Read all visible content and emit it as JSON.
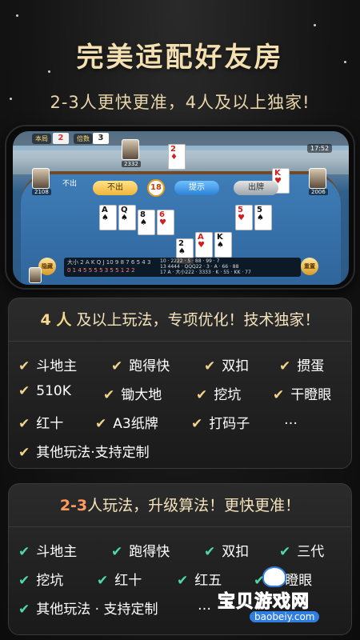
{
  "header": {
    "headline": "完美适配好友房",
    "subline": "2-3人更快更准，4人及以上独家!"
  },
  "screenshot": {
    "top_mult_label": "倍数",
    "top_base_label": "本局",
    "top_base_value": "2",
    "top_mult_value": "3",
    "clock": "17:52",
    "player_top_score": "2332",
    "player_left_score": "2108",
    "player_right_score": "2006",
    "chu_label": "不出",
    "timer": "18",
    "btn_pass": "不出",
    "btn_hint": "提示",
    "btn_play": "出牌",
    "left_btn": "隐藏",
    "right_btn": "重置",
    "tracker_row1": "大小 2 A K Q J 10 9 8 7 6 5 4 3",
    "tracker_row2": "0 1 4 5 5 5 5 3 5 5 1 2 2",
    "tracker_side": "10 · 2222 · 5 · 88 · 99 · 7\n13 4444 · QQQ22 · 3 · A · 66 · 88\n17 A · 大小222 · 3333 · K · 55 · KK · 77",
    "played_card": "2",
    "right_card": "K",
    "hand_cards": [
      {
        "r": "A",
        "s": "♠",
        "c": "blk"
      },
      {
        "r": "Q",
        "s": "♠",
        "c": "blk"
      },
      {
        "r": "10",
        "s": "♠",
        "c": "blk"
      },
      {
        "r": "8",
        "s": "♠",
        "c": "blk"
      },
      {
        "r": "6",
        "s": "♥",
        "c": "red"
      },
      {
        "r": "2",
        "s": "♠",
        "c": "blk"
      },
      {
        "r": "A",
        "s": "♥",
        "c": "red"
      },
      {
        "r": "K",
        "s": "♠",
        "c": "blk"
      },
      {
        "r": "5",
        "s": "♥",
        "c": "red"
      },
      {
        "r": "5",
        "s": "♠",
        "c": "blk"
      }
    ]
  },
  "panel1": {
    "title_em": "4 人",
    "title_rest": "及以上玩法，专项优化！技术独家！",
    "items": [
      "斗地主",
      "跑得快",
      "双扣",
      "掼蛋",
      "510K",
      "锄大地",
      "挖坑",
      "干瞪眼",
      "红十",
      "A3纸牌",
      "打码子",
      "…",
      "其他玩法·支持定制"
    ]
  },
  "panel2": {
    "title_em": "2-3",
    "title_rest": "人玩法，升级算法！更快更准！",
    "items": [
      "斗地主",
      "跑得快",
      "双扣",
      "三代",
      "挖坑",
      "红十",
      "红五",
      "干瞪眼",
      "其他玩法 · 支持定制",
      "…"
    ]
  },
  "watermark": {
    "brand": "宝贝游戏网",
    "url": "baobeiy.com"
  },
  "colors": {
    "gold": "#f1d38a",
    "green": "#4fdaa6",
    "brand_blue": "#2f7de0"
  }
}
